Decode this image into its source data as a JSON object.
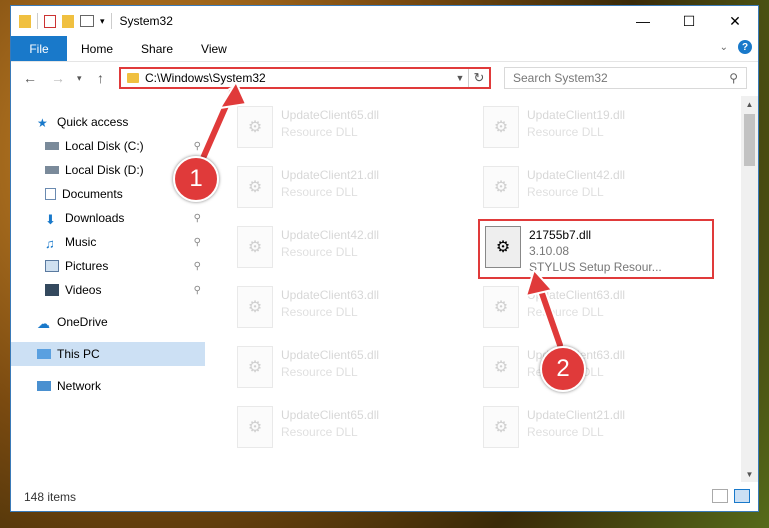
{
  "window": {
    "title": "System32",
    "minimize_glyph": "—",
    "maximize_glyph": "☐",
    "close_glyph": "✕"
  },
  "ribbon": {
    "tabs": [
      "File",
      "Home",
      "Share",
      "View"
    ],
    "help": "?"
  },
  "address": {
    "path": "C:\\Windows\\System32",
    "search_placeholder": "Search System32"
  },
  "sidebar": {
    "items": [
      {
        "label": "Quick access",
        "icon": "star-icon",
        "pinned": false
      },
      {
        "label": "Local Disk (C:)",
        "icon": "drive-icon",
        "pinned": true
      },
      {
        "label": "Local Disk (D:)",
        "icon": "drive-icon",
        "pinned": false
      },
      {
        "label": "Documents",
        "icon": "documents-icon",
        "pinned": true
      },
      {
        "label": "Downloads",
        "icon": "download-icon",
        "pinned": true
      },
      {
        "label": "Music",
        "icon": "music-icon",
        "pinned": true
      },
      {
        "label": "Pictures",
        "icon": "pictures-icon",
        "pinned": true
      },
      {
        "label": "Videos",
        "icon": "videos-icon",
        "pinned": true
      },
      {
        "label": "OneDrive",
        "icon": "cloud-icon",
        "pinned": false
      },
      {
        "label": "This PC",
        "icon": "computer-icon",
        "pinned": false,
        "selected": true
      },
      {
        "label": "Network",
        "icon": "network-icon",
        "pinned": false
      }
    ]
  },
  "files": [
    {
      "name": "UpdateClient65.dll",
      "type": "Resource DLL"
    },
    {
      "name": "UpdateClient19.dll",
      "type": "Resource DLL"
    },
    {
      "name": "UpdateClient21.dll",
      "type": "Resource DLL"
    },
    {
      "name": "UpdateClient42.dll",
      "type": "Resource DLL"
    },
    {
      "name": "UpdateClient42.dll",
      "type": "Resource DLL"
    },
    {
      "name": "21755b7.dll",
      "version": "3.10.08",
      "type": "STYLUS Setup Resour...",
      "highlighted": true
    },
    {
      "name": "UpdateClient63.dll",
      "type": "Resource DLL"
    },
    {
      "name": "UpdateClient63.dll",
      "type": "Resource DLL"
    },
    {
      "name": "UpdateClient65.dll",
      "type": "Resource DLL"
    },
    {
      "name": "UpdateClient63.dll",
      "type": "Resource DLL"
    },
    {
      "name": "UpdateClient65.dll",
      "type": "Resource DLL"
    },
    {
      "name": "UpdateClient21.dll",
      "type": "Resource DLL"
    }
  ],
  "status": {
    "item_count": "148 items"
  },
  "callouts": [
    "1",
    "2"
  ],
  "colors": {
    "accent": "#1979ca",
    "highlight": "#e03a3a"
  }
}
